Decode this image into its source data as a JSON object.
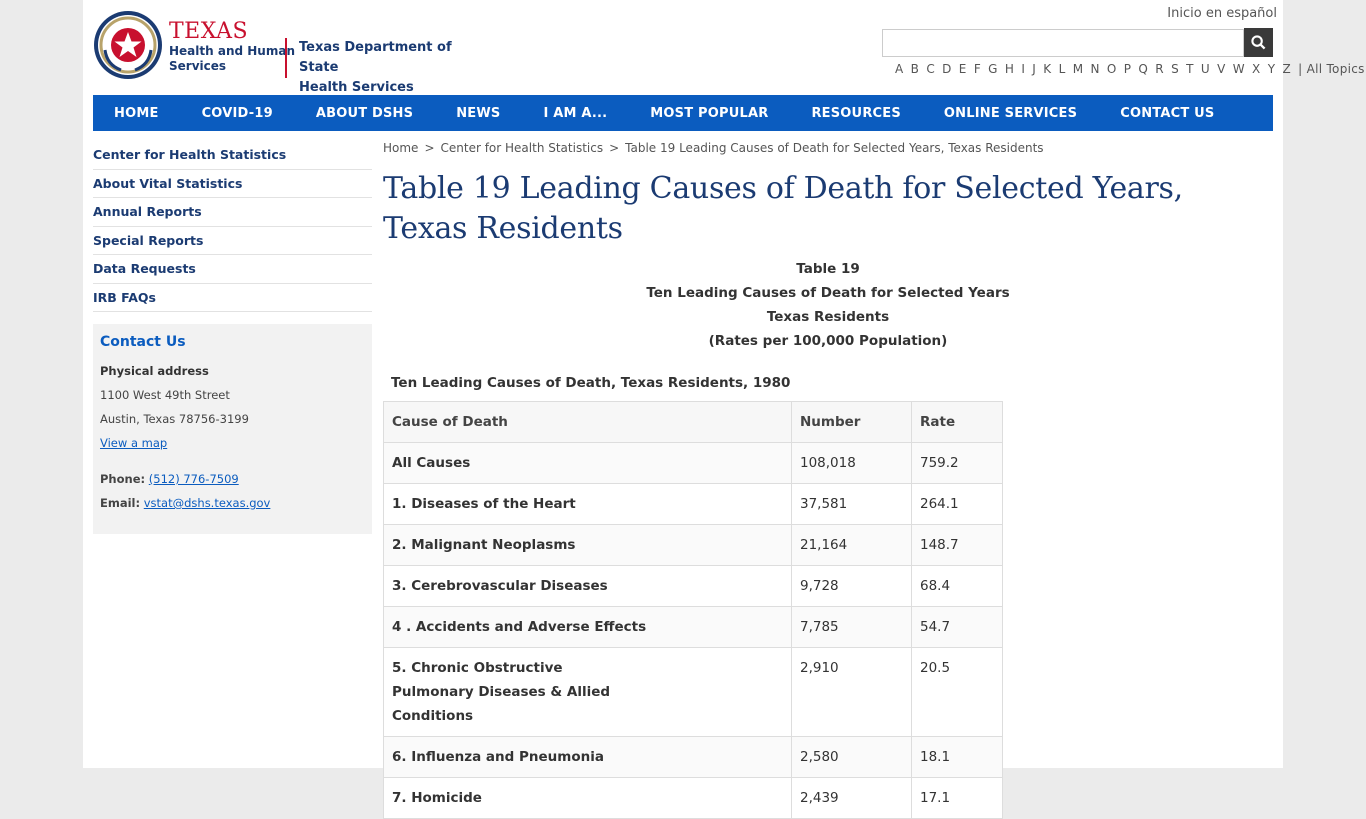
{
  "header": {
    "brand_texas": "TEXAS",
    "brand_hhs_line1": "Health and Human",
    "brand_hhs_line2": "Services",
    "dshs_line1": "Texas Department of State",
    "dshs_line2": "Health Services",
    "spanish_link": "Inicio en español",
    "search_placeholder": "",
    "az_letters": [
      "A",
      "B",
      "C",
      "D",
      "E",
      "F",
      "G",
      "H",
      "I",
      "J",
      "K",
      "L",
      "M",
      "N",
      "O",
      "P",
      "Q",
      "R",
      "S",
      "T",
      "U",
      "V",
      "W",
      "X",
      "Y",
      "Z"
    ],
    "az_all": "| All Topics"
  },
  "nav": {
    "items": [
      "HOME",
      "COVID-19",
      "ABOUT DSHS",
      "NEWS",
      "I AM A...",
      "MOST POPULAR",
      "RESOURCES",
      "ONLINE SERVICES",
      "CONTACT US"
    ]
  },
  "sidebar": {
    "links": [
      "Center for Health Statistics",
      "About Vital Statistics",
      "Annual Reports",
      "Special Reports",
      "Data Requests",
      "IRB FAQs"
    ],
    "contact": {
      "title": "Contact Us",
      "address_label": "Physical address",
      "address_line1": "1100 West 49th Street",
      "address_line2": "Austin, Texas 78756-3199",
      "map_link": "View a map",
      "phone_label": "Phone:",
      "phone": "(512) 776-7509",
      "email_label": "Email:",
      "email": "vstat@dshs.texas.gov"
    }
  },
  "breadcrumb": {
    "home": "Home",
    "section": "Center for Health Statistics",
    "current": "Table 19 Leading Causes of Death for Selected Years, Texas Residents",
    "sep": ">"
  },
  "page_title": "Table 19 Leading Causes of Death for Selected Years, Texas Residents",
  "caption": {
    "line1": "Table 19",
    "line2": "Ten Leading Causes of Death for Selected Years",
    "line3": "Texas Residents",
    "line4": "(Rates per 100,000 Population)"
  },
  "table_1980": {
    "subtitle": "Ten Leading Causes of Death, Texas Residents, 1980",
    "headers": [
      "Cause of Death",
      "Number",
      "Rate"
    ],
    "rows": [
      [
        "All Causes",
        "108,018",
        "759.2"
      ],
      [
        "1. Diseases of the Heart",
        "37,581",
        "264.1"
      ],
      [
        "2. Malignant Neoplasms",
        "21,164",
        "148.7"
      ],
      [
        "3. Cerebrovascular Diseases",
        "9,728",
        "68.4"
      ],
      [
        "4 . Accidents and Adverse Effects",
        "7,785",
        "54.7"
      ],
      [
        "5. Chronic Obstructive Pulmonary Diseases & Allied Conditions",
        "2,910",
        "20.5"
      ],
      [
        "6. Influenza and Pneumonia",
        "2,580",
        "18.1"
      ],
      [
        "7. Homicide",
        "2,439",
        "17.1"
      ]
    ]
  },
  "colors": {
    "nav_blue": "#0b5cbf",
    "title_navy": "#1b3b72",
    "brand_red": "#c8102e"
  }
}
